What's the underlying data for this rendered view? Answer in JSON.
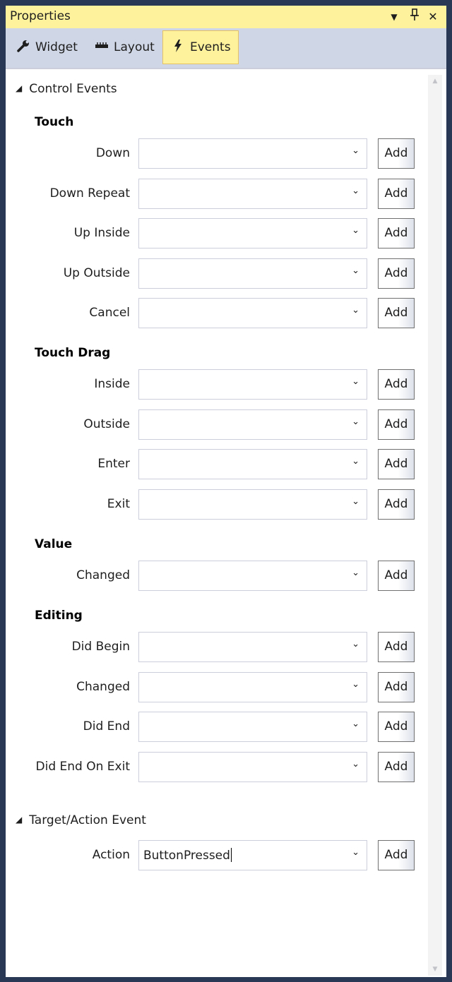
{
  "window": {
    "title": "Properties",
    "controls": {
      "dropdown": "▼",
      "pin": "⊥",
      "close": "✕"
    }
  },
  "tabs": [
    {
      "label": "Widget",
      "icon": "wrench-icon",
      "active": false
    },
    {
      "label": "Layout",
      "icon": "ruler-icon",
      "active": false
    },
    {
      "label": "Events",
      "icon": "lightning-icon",
      "active": true
    }
  ],
  "control_events": {
    "header": "Control Events",
    "add_label": "Add",
    "groups": [
      {
        "title": "Touch",
        "rows": [
          "Down",
          "Down Repeat",
          "Up Inside",
          "Up Outside",
          "Cancel"
        ]
      },
      {
        "title": "Touch Drag",
        "rows": [
          "Inside",
          "Outside",
          "Enter",
          "Exit"
        ]
      },
      {
        "title": "Value",
        "rows": [
          "Changed"
        ]
      },
      {
        "title": "Editing",
        "rows": [
          "Did Begin",
          "Changed",
          "Did End",
          "Did End On Exit"
        ]
      }
    ]
  },
  "target_action": {
    "header": "Target/Action Event",
    "row": {
      "label": "Action",
      "value": "ButtonPressed",
      "add_label": "Add"
    }
  },
  "colors": {
    "frame": "#293955",
    "title_bg": "#fff29d",
    "toolbar_bg": "#cfd6e5",
    "active_tab_bg": "#fff29d"
  }
}
